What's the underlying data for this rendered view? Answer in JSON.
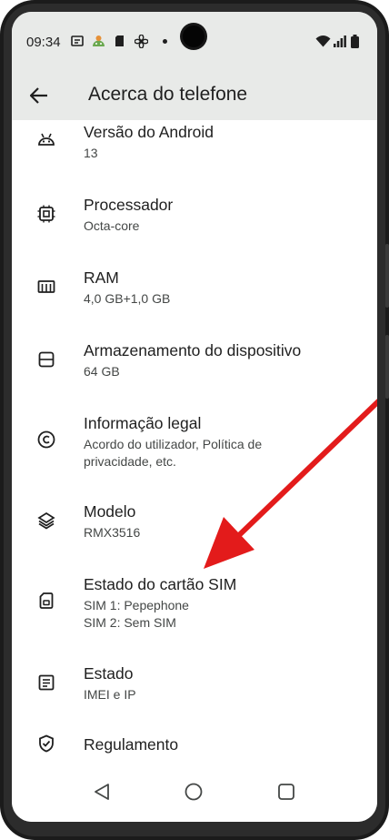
{
  "status_bar": {
    "time": "09:34",
    "icons": [
      "message-icon",
      "android-icon",
      "sim-icon",
      "fan-icon",
      "dot-icon",
      "wifi-icon",
      "signal-icon",
      "battery-icon"
    ]
  },
  "app_bar": {
    "title": "Acerca do telefone",
    "back_icon": "arrow-left-icon"
  },
  "settings": [
    {
      "title": "Versão do Android",
      "subtitle": "13",
      "icon": "android-icon"
    },
    {
      "title": "Processador",
      "subtitle": "Octa-core",
      "icon": "chip-icon"
    },
    {
      "title": "RAM",
      "subtitle": "4,0 GB+1,0 GB",
      "icon": "memory-icon"
    },
    {
      "title": "Armazenamento do dispositivo",
      "subtitle": "64 GB",
      "icon": "storage-icon"
    },
    {
      "title": "Informação legal",
      "subtitle_1": "Acordo do utilizador, Política de",
      "subtitle_2": "privacidade, etc.",
      "icon": "copyright-icon"
    },
    {
      "title": "Modelo",
      "subtitle": "RMX3516",
      "icon": "layers-icon"
    },
    {
      "title": "Estado do cartão SIM",
      "subtitle_1": "SIM 1: Pepephone",
      "subtitle_2": "SIM 2: Sem SIM",
      "icon": "sim-card-icon"
    },
    {
      "title": "Estado",
      "subtitle": "IMEI e IP",
      "icon": "document-icon"
    },
    {
      "title": "Regulamento",
      "icon": "shield-check-icon"
    }
  ],
  "nav_bar": {
    "icons": [
      "back-triangle-icon",
      "home-circle-icon",
      "recents-square-icon"
    ]
  },
  "colors": {
    "header_bg": "#e8eae8",
    "text_primary": "#1f1f1f",
    "text_secondary": "#444746",
    "annotation_arrow": "#e31b1b"
  }
}
